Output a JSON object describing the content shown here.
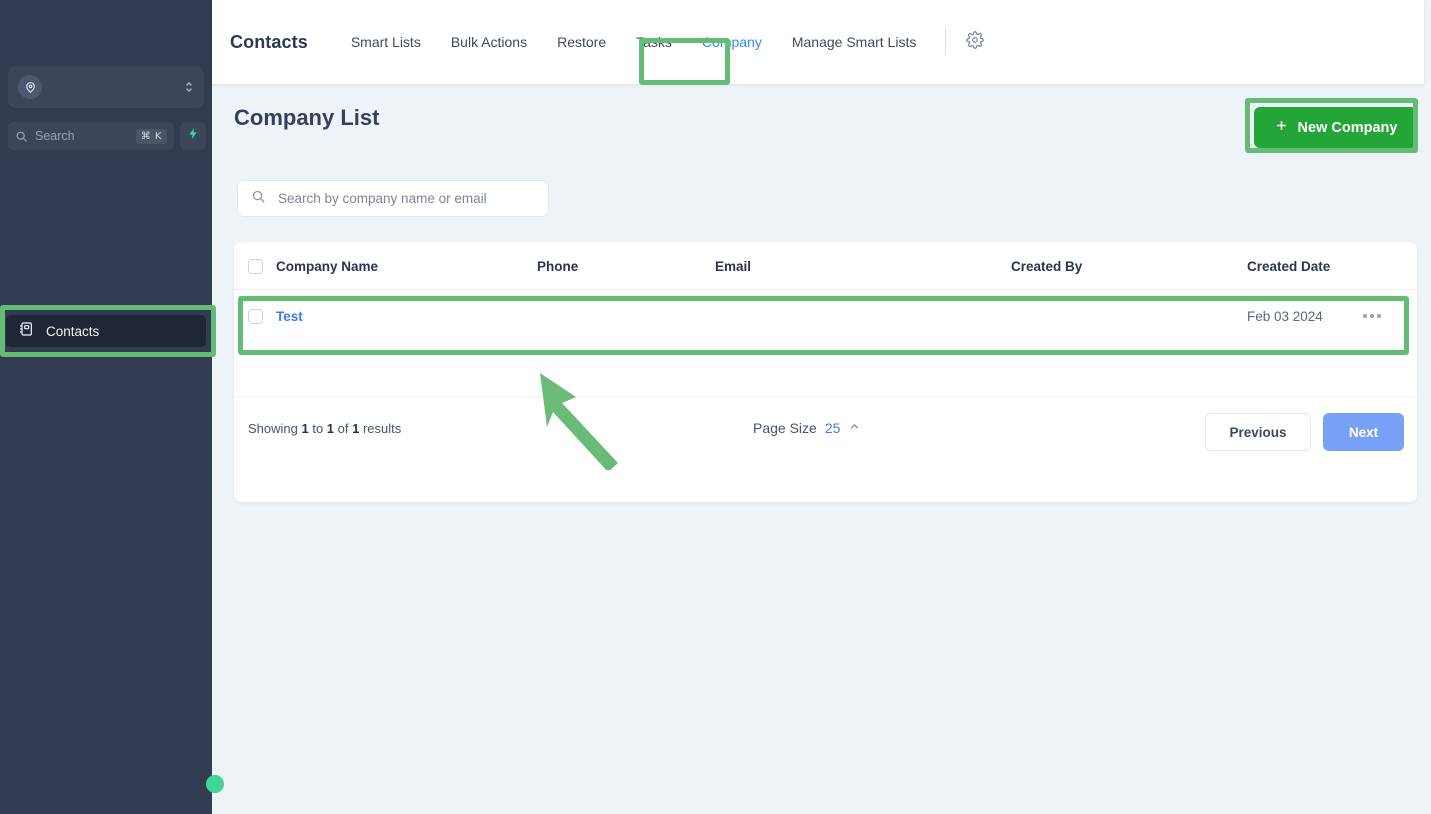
{
  "sidebar": {
    "account_switcher": {
      "name": "",
      "icon": "location-pin-user-icon"
    },
    "search": {
      "placeholder": "Search",
      "shortcut": "⌘ K",
      "icon": "search-icon"
    },
    "quick_action": {
      "icon": "lightning-bolt-icon"
    },
    "items": [
      {
        "label": "Contacts",
        "icon": "address-book-icon",
        "active": true
      }
    ]
  },
  "header": {
    "brand": "Contacts",
    "tabs": [
      {
        "label": "Smart Lists",
        "active": false
      },
      {
        "label": "Bulk Actions",
        "active": false
      },
      {
        "label": "Restore",
        "active": false
      },
      {
        "label": "Tasks",
        "active": false
      },
      {
        "label": "Company",
        "active": true
      },
      {
        "label": "Manage Smart Lists",
        "active": false
      }
    ],
    "settings_icon": "gear-icon"
  },
  "main": {
    "page_title": "Company List",
    "new_company_button": "New Company",
    "search": {
      "placeholder": "Search by company name or email",
      "value": "",
      "icon": "search-icon"
    },
    "table": {
      "columns": [
        "Company Name",
        "Phone",
        "Email",
        "Created By",
        "Created Date"
      ],
      "rows": [
        {
          "company_name": "Test",
          "phone": "",
          "email": "",
          "created_by": "",
          "created_date": "Feb 03 2024"
        }
      ]
    },
    "footer": {
      "showing_prefix": "Showing ",
      "showing_from": "1",
      "showing_mid": " to ",
      "showing_to": "1",
      "showing_of": " of ",
      "showing_total": "1",
      "showing_suffix": " results",
      "page_size_label": "Page Size",
      "page_size_value": "25",
      "previous_label": "Previous",
      "next_label": "Next"
    }
  },
  "colors": {
    "sidebar_bg": "#323c50",
    "accent_green": "#23a637",
    "highlight_green": "#64bd74",
    "link_blue": "#3d7de8",
    "tab_active_blue": "#2f8fe8",
    "next_button_blue": "#78a0f5"
  }
}
